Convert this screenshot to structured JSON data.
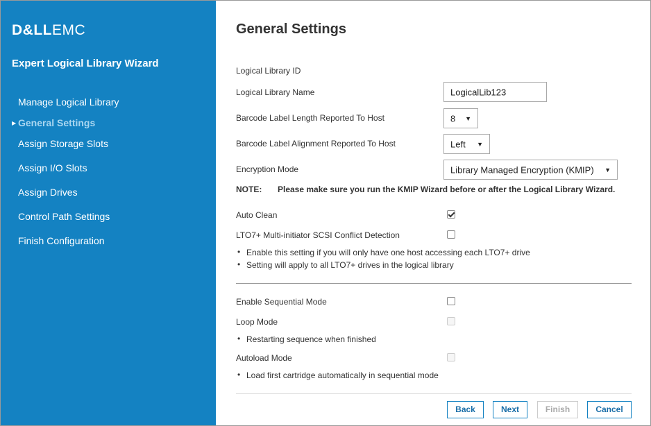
{
  "sidebar": {
    "logo_bold": "D&LL",
    "logo_light": "EMC",
    "wizard_title": "Expert Logical Library Wizard",
    "items": [
      {
        "label": "Manage Logical Library"
      },
      {
        "label": "General Settings"
      },
      {
        "label": "Assign Storage Slots"
      },
      {
        "label": "Assign I/O Slots"
      },
      {
        "label": "Assign Drives"
      },
      {
        "label": "Control Path Settings"
      },
      {
        "label": "Finish Configuration"
      }
    ],
    "active_item": "General Settings",
    "colors": {
      "background": "#1482c2",
      "active_text": "#a9d6f0"
    }
  },
  "main": {
    "title": "General Settings",
    "fields": {
      "library_id_label": "Logical Library ID",
      "library_name_label": "Logical Library Name",
      "library_name_value": "LogicalLib123",
      "barcode_length_label": "Barcode Label Length Reported To Host",
      "barcode_length_value": "8",
      "barcode_alignment_label": "Barcode Label Alignment Reported To Host",
      "barcode_alignment_value": "Left",
      "encryption_label": "Encryption Mode",
      "encryption_value": "Library Managed Encryption (KMIP)"
    },
    "note": {
      "label": "NOTE:",
      "message": "Please make sure you run the KMIP Wizard before or after the Logical Library Wizard."
    },
    "auto_clean": {
      "label": "Auto Clean",
      "checked": true
    },
    "lto7": {
      "label": "LTO7+ Multi-initiator SCSI Conflict Detection",
      "checked": false,
      "bullets": [
        "Enable this setting if you will only have one host accessing each LTO7+ drive",
        "Setting will apply to all LTO7+ drives in the logical library"
      ]
    },
    "sequential": {
      "label": "Enable Sequential Mode",
      "checked": false
    },
    "loop": {
      "label": "Loop Mode",
      "checked": false,
      "disabled": true,
      "bullet": "Restarting sequence when finished"
    },
    "autoload": {
      "label": "Autoload Mode",
      "checked": false,
      "disabled": true,
      "bullet": "Load first cartridge automatically in sequential mode"
    },
    "buttons": {
      "back": "Back",
      "next": "Next",
      "finish": "Finish",
      "cancel": "Cancel"
    },
    "bullet_glyph": "•",
    "caret_glyph": "▼",
    "arrow_glyph": "▶"
  }
}
